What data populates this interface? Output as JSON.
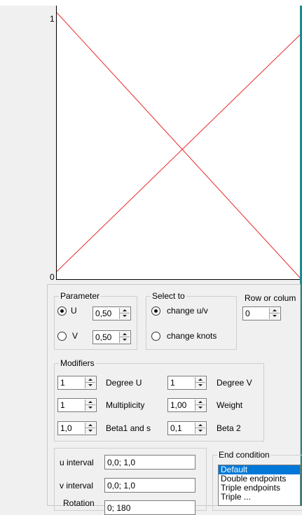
{
  "plot": {
    "y_top_label": "1",
    "origin_label": "0",
    "line_color": "#e8282a"
  },
  "parameter": {
    "legend": "Parameter",
    "u_label": "U",
    "u_value": "0,50",
    "u_selected": true,
    "v_label": "V",
    "v_value": "0,50",
    "v_selected": false
  },
  "select_to": {
    "legend": "Select to",
    "option1": "change u/v",
    "option1_selected": true,
    "option2": "change knots",
    "option2_selected": false
  },
  "row_col": {
    "legend": "Row or colum",
    "value": "0"
  },
  "modifiers": {
    "legend": "Modifiers",
    "degree_u_value": "1",
    "degree_u_label": "Degree U",
    "degree_v_value": "1",
    "degree_v_label": "Degree V",
    "multiplicity_value": "1",
    "multiplicity_label": "Multiplicity",
    "weight_value": "1,00",
    "weight_label": "Weight",
    "beta1_value": "1,0",
    "beta1_label": "Beta1 and s",
    "beta2_value": "0,1",
    "beta2_label": "Beta 2"
  },
  "intervals": {
    "u_label": "u interval",
    "u_value": "0,0; 1,0",
    "v_label": "v interval",
    "v_value": "0,0; 1,0",
    "rotation_label": "Rotation",
    "rotation_value": "0; 180"
  },
  "end_condition": {
    "legend": "End condition",
    "items": [
      "Default",
      "Double endpoints",
      "Triple endpoints",
      "Triple ..."
    ],
    "selected_index": 0
  }
}
